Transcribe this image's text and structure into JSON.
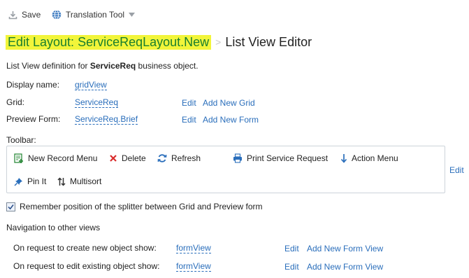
{
  "toolbar_top": {
    "save_label": "Save",
    "translation_label": "Translation Tool"
  },
  "title": {
    "edit_layout": "Edit Layout: ServiceReqLayout.New",
    "separator": ">",
    "editor": "List View Editor"
  },
  "description": {
    "prefix": "List View definition for ",
    "object": "ServiceReq",
    "suffix": " business object."
  },
  "fields": {
    "display_name_label": "Display name:",
    "display_name_value": "gridView",
    "grid_label": "Grid:",
    "grid_value": "ServiceReq",
    "grid_edit": "Edit",
    "grid_add": "Add New Grid",
    "preview_label": "Preview Form:",
    "preview_value": "ServiceReq.Brief",
    "preview_edit": "Edit",
    "preview_add": "Add New Form"
  },
  "toolbar_section": {
    "label": "Toolbar:",
    "edit": "Edit",
    "items": [
      {
        "label": "New Record Menu",
        "icon": "new-record-icon"
      },
      {
        "label": "Delete",
        "icon": "delete-x-icon"
      },
      {
        "label": "Refresh",
        "icon": "refresh-icon"
      },
      {
        "label": "Print Service Request",
        "icon": "printer-icon"
      },
      {
        "label": "Action Menu",
        "icon": "down-arrow-icon"
      },
      {
        "label": "Pin It",
        "icon": "pin-icon"
      },
      {
        "label": "Multisort",
        "icon": "sort-arrows-icon"
      }
    ]
  },
  "remember": {
    "checked": true,
    "label": "Remember position of the splitter between Grid and Preview form"
  },
  "navigation": {
    "heading": "Navigation to other views",
    "create_label": "On request to create new object show:",
    "create_value": "formView",
    "create_edit": "Edit",
    "create_add": "Add New Form View",
    "edit_label": "On request to edit existing object show:",
    "edit_value": "formView",
    "edit_edit": "Edit",
    "edit_add": "Add New Form View"
  },
  "colors": {
    "highlight": "#f2f53a",
    "title_green": "#1a7f2e",
    "link_blue": "#2a6ebb",
    "delete_red": "#d92b2b"
  }
}
